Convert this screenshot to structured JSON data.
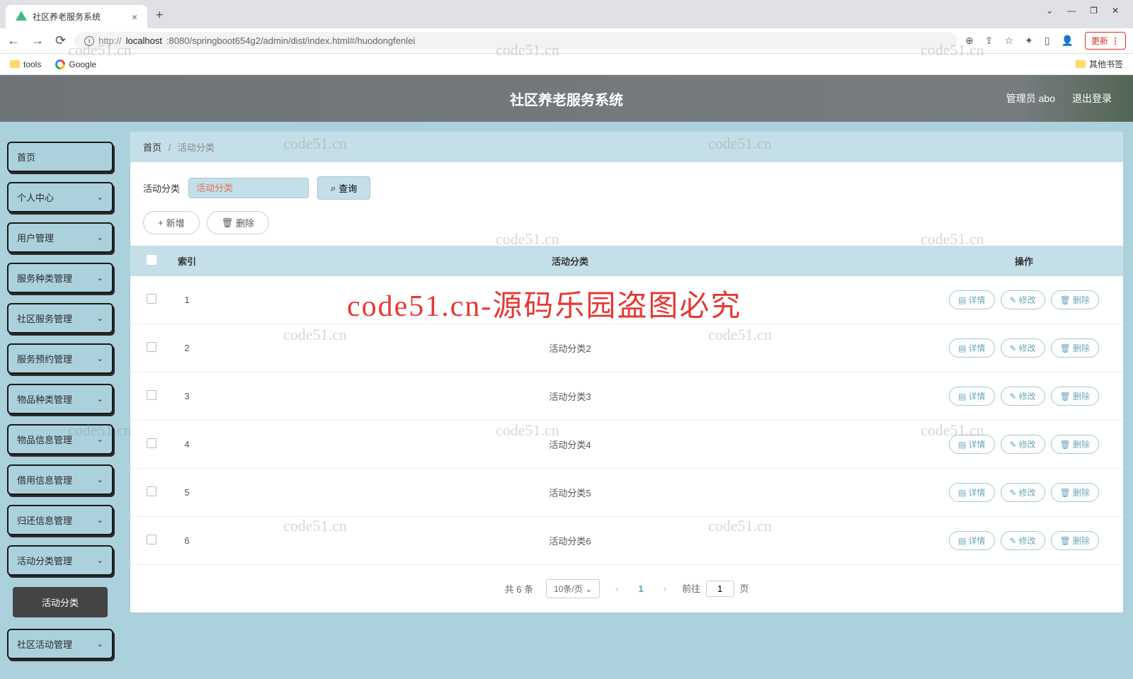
{
  "browser": {
    "tab_title": "社区养老服务系统",
    "url_prefix": "http://",
    "url_host": "localhost",
    "url_path": ":8080/springboot654g2/admin/dist/index.html#/huodongfenlei",
    "update_btn": "更新",
    "bookmarks": {
      "tools": "tools",
      "google": "Google",
      "other": "其他书签"
    }
  },
  "header": {
    "title": "社区养老服务系统",
    "user_label": "管理员 abo",
    "logout": "退出登录"
  },
  "sidebar": {
    "items": [
      {
        "label": "首页",
        "expandable": false
      },
      {
        "label": "个人中心",
        "expandable": true
      },
      {
        "label": "用户管理",
        "expandable": true
      },
      {
        "label": "服务种类管理",
        "expandable": true
      },
      {
        "label": "社区服务管理",
        "expandable": true
      },
      {
        "label": "服务预约管理",
        "expandable": true
      },
      {
        "label": "物品种类管理",
        "expandable": true
      },
      {
        "label": "物品信息管理",
        "expandable": true
      },
      {
        "label": "借用信息管理",
        "expandable": true
      },
      {
        "label": "归还信息管理",
        "expandable": true
      },
      {
        "label": "活动分类管理",
        "expandable": true
      },
      {
        "label": "社区活动管理",
        "expandable": true
      }
    ],
    "submenu": "活动分类"
  },
  "breadcrumb": {
    "home": "首页",
    "current": "活动分类"
  },
  "filter": {
    "label": "活动分类",
    "placeholder": "活动分类",
    "search_btn": "查询"
  },
  "actions": {
    "add": "新增",
    "del": "删除"
  },
  "table": {
    "headers": {
      "index": "索引",
      "category": "活动分类",
      "ops": "操作"
    },
    "op_labels": {
      "detail": "详情",
      "edit": "修改",
      "del": "删除"
    },
    "rows": [
      {
        "idx": "1",
        "cat": ""
      },
      {
        "idx": "2",
        "cat": "活动分类2"
      },
      {
        "idx": "3",
        "cat": "活动分类3"
      },
      {
        "idx": "4",
        "cat": "活动分类4"
      },
      {
        "idx": "5",
        "cat": "活动分类5"
      },
      {
        "idx": "6",
        "cat": "活动分类6"
      }
    ]
  },
  "pagination": {
    "total": "共 6 条",
    "per_page": "10条/页",
    "current": "1",
    "goto_prefix": "前往",
    "goto_value": "1",
    "goto_suffix": "页"
  },
  "watermarks": {
    "small": "code51.cn",
    "big": "code51.cn-源码乐园盗图必究"
  }
}
